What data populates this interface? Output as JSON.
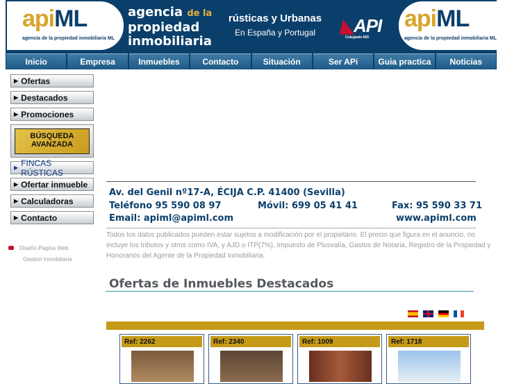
{
  "header": {
    "logo_api": "api",
    "logo_ml": "ML",
    "logo_tagline": "agencia de la propiedad inmobiliaria ML",
    "agency_line1": "agencia",
    "agency_line1_small": "de la",
    "agency_line2": "propiedad",
    "agency_line3": "inmobiliaria",
    "tagline": "rústicas y Urbanas",
    "subtagline": "En España y Portugal",
    "api_mark": "API",
    "colegiado": "Colegiado 669"
  },
  "nav": [
    "Inicio",
    "Empresa",
    "Inmuebles",
    "Contacto",
    "Situación",
    "Ser APi",
    "Guia practica",
    "Noticias"
  ],
  "sidebar": {
    "items_top": [
      "Ofertas",
      "Destacados",
      "Promociones"
    ],
    "busqueda_line1": "BÚSQUEDA",
    "busqueda_line2": "AVANZADA",
    "fincas": "FINCAS RÚSTICAS",
    "items_bottom": [
      "Ofertar inmueble",
      "Calculadoras",
      "Contacto"
    ],
    "link1": "Diseño Pagina Web",
    "link2": "Gestion Inmobiliaria"
  },
  "contact": {
    "address": "Av. del Genil nº17-A, ÉCIJA C.P. 41400 (Sevilla)",
    "telefono": "Teléfono 95 590 08 97",
    "movil": "Móvil: 699 05 41 41",
    "fax": "Fax: 95 590 33 71",
    "email": "Email: apiml@apiml.com",
    "web": "www.apiml.com"
  },
  "disclaimer": "Todos los datos publicados pueden estar sujetos a modificación por el propietario. El precio que figura en el anuncio, no incluye los tributos y otros como IVA, y AJD o ITP(7%), Impuesto de Plusvalía, Gastos de Notaria, Registro de la Propiedad y Honorarios del Agente de la Propiedad Inmobiliaria.",
  "section_title": "Ofertas de Inmuebles Destacados",
  "languages": [
    "es",
    "en",
    "de",
    "fr"
  ],
  "cards": [
    {
      "ref": "Ref: 2262"
    },
    {
      "ref": "Ref: 2340"
    },
    {
      "ref": "Ref: 1009"
    },
    {
      "ref": "Ref: 1718"
    }
  ],
  "colors": {
    "navy": "#0b3f6b",
    "gold": "#c59a16",
    "accent_gold": "#d8a42a"
  }
}
